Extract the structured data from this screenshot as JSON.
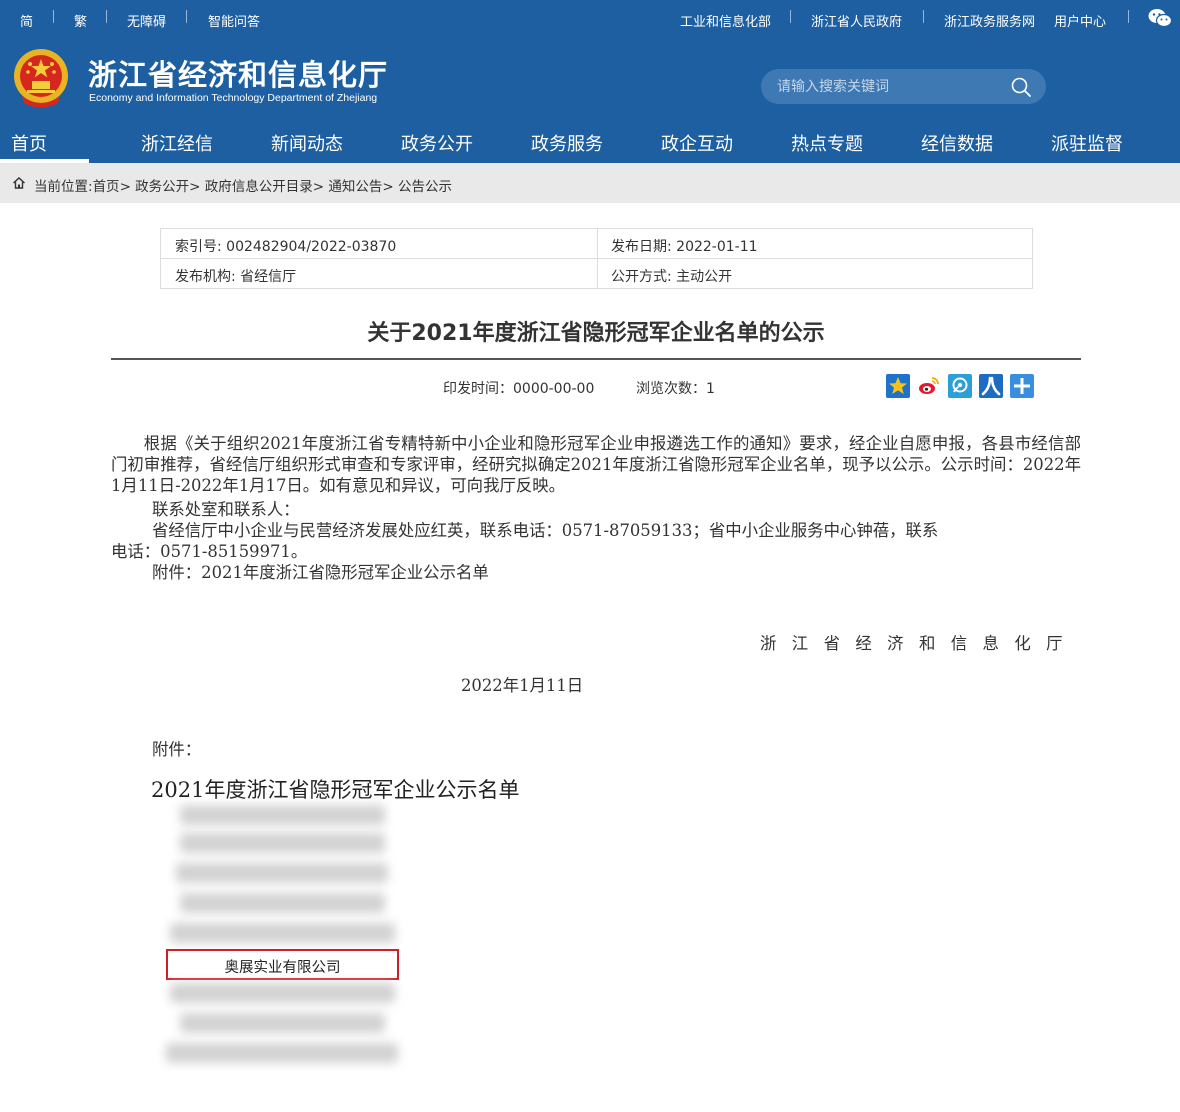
{
  "topbar": {
    "left": [
      "简",
      "繁",
      "无障碍",
      "智能问答"
    ],
    "right": [
      "工业和信息化部",
      "浙江省人民政府",
      "浙江政务服务网",
      "用户中心"
    ],
    "wechat_icon": "wechat-icon"
  },
  "site": {
    "title": "浙江省经济和信息化厅",
    "subtitle": "Economy and Information Technology Department of Zhejiang",
    "emblem_icon": "national-emblem-icon"
  },
  "search": {
    "placeholder": "请输入搜索关键词",
    "icon": "search-icon"
  },
  "nav": [
    "首页",
    "浙江经信",
    "新闻动态",
    "政务公开",
    "政务服务",
    "政企互动",
    "热点专题",
    "经信数据",
    "派驻监督"
  ],
  "breadcrumb": {
    "icon": "home-icon",
    "prefix": "当前位置:",
    "items": [
      "首页",
      "政务公开",
      "政府信息公开目录",
      "通知公告",
      "公告公示"
    ],
    "separator": ">"
  },
  "meta": {
    "index_label": "索引号:",
    "index_value": "002482904/2022-03870",
    "date_label": "发布日期:",
    "date_value": "2022-01-11",
    "org_label": "发布机构:",
    "org_value": "省经信厅",
    "mode_label": "公开方式:",
    "mode_value": "主动公开"
  },
  "article": {
    "title": "关于2021年度浙江省隐形冠军企业名单的公示",
    "print_time_label": "印发时间：",
    "print_time_value": "0000-00-00",
    "views_label": "浏览次数：",
    "views_value": "1",
    "share_icons": [
      "qzone-star-icon",
      "weibo-icon",
      "tencent-weibo-icon",
      "renren-icon",
      "more-share-icon"
    ],
    "p1": "根据《关于组织2021年度浙江省专精特新中小企业和隐形冠军企业申报遴选工作的通知》要求，经企业自愿申报，各县市经信部门初审推荐，省经信厅组织形式审查和专家评审，经研究拟确定2021年度浙江省隐形冠军企业名单，现予以公示。公示时间：2022年1月11日-2022年1月17日。如有意见和异议，可向我厅反映。",
    "contact_title": "联系处室和联系人：",
    "contact_line1": "省经信厅中小企业与民营经济发展处应红英，联系电话：0571-87059133；省中小企业服务中心钟蓓，联系",
    "contact_line2": "电话：0571-85159971。",
    "attachment_line": "附件：2021年度浙江省隐形冠军企业公示名单",
    "signature": "浙江省经济和信息化厅",
    "sign_date": "2022年1月11日",
    "attachment_label": "附件：",
    "list_title": "2021年度浙江省隐形冠军企业公示名单",
    "highlighted_company": "奥展实业有限公司"
  },
  "colors": {
    "brand": "#1d5fa0",
    "highlight": "#d01f24"
  }
}
